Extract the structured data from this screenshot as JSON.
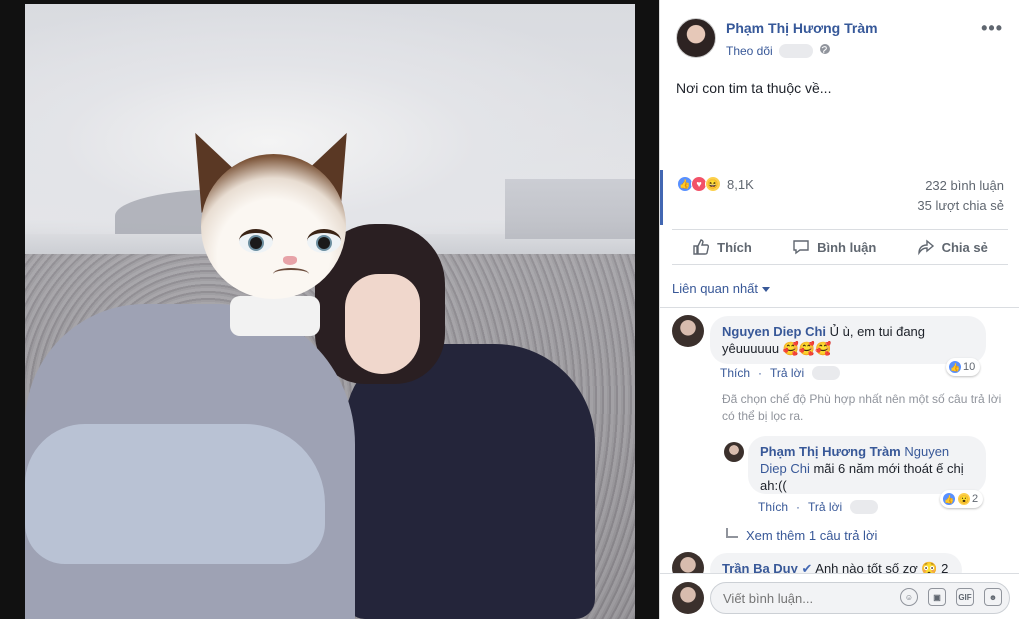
{
  "post": {
    "author": "Phạm Thị Hương Tràm",
    "follow_label": "Theo dõi",
    "text": "Nơi con tim ta thuộc về...",
    "reactions_count": "8,1K",
    "comments_count": "232 bình luận",
    "shares_count": "35 lượt chia sẻ"
  },
  "actions": {
    "like": "Thích",
    "comment": "Bình luận",
    "share": "Chia sẻ"
  },
  "sort_label": "Liên quan nhất",
  "comments": [
    {
      "name": "Nguyen Diep Chi",
      "text_line1": " Ủ ù, em tui đang",
      "text_line2": "yêuuuuuu 🥰🥰🥰",
      "like": "Thích",
      "reply": "Trả lời",
      "reaction_count": "10"
    },
    {
      "name": "Phạm Thị Hương Tràm",
      "tag": " Nguyen",
      "text_line2": "Diep Chi",
      "text_line2b": " mãi 6 năm mới thoát ế chị",
      "text_line3": "ah:((",
      "like": "Thích",
      "reply": "Trả lời",
      "reaction_count": "2"
    },
    {
      "name": "Trần Ba Duy",
      "text": " Anh nào tốt số zợ 😳 2"
    }
  ],
  "filtered_notice": "Đã chọn chế độ Phù hợp nhất nên một số câu trả lời có thể bị lọc ra.",
  "see_more": "Xem thêm 1 câu trả lời",
  "composer": {
    "placeholder": "Viết bình luận..."
  }
}
